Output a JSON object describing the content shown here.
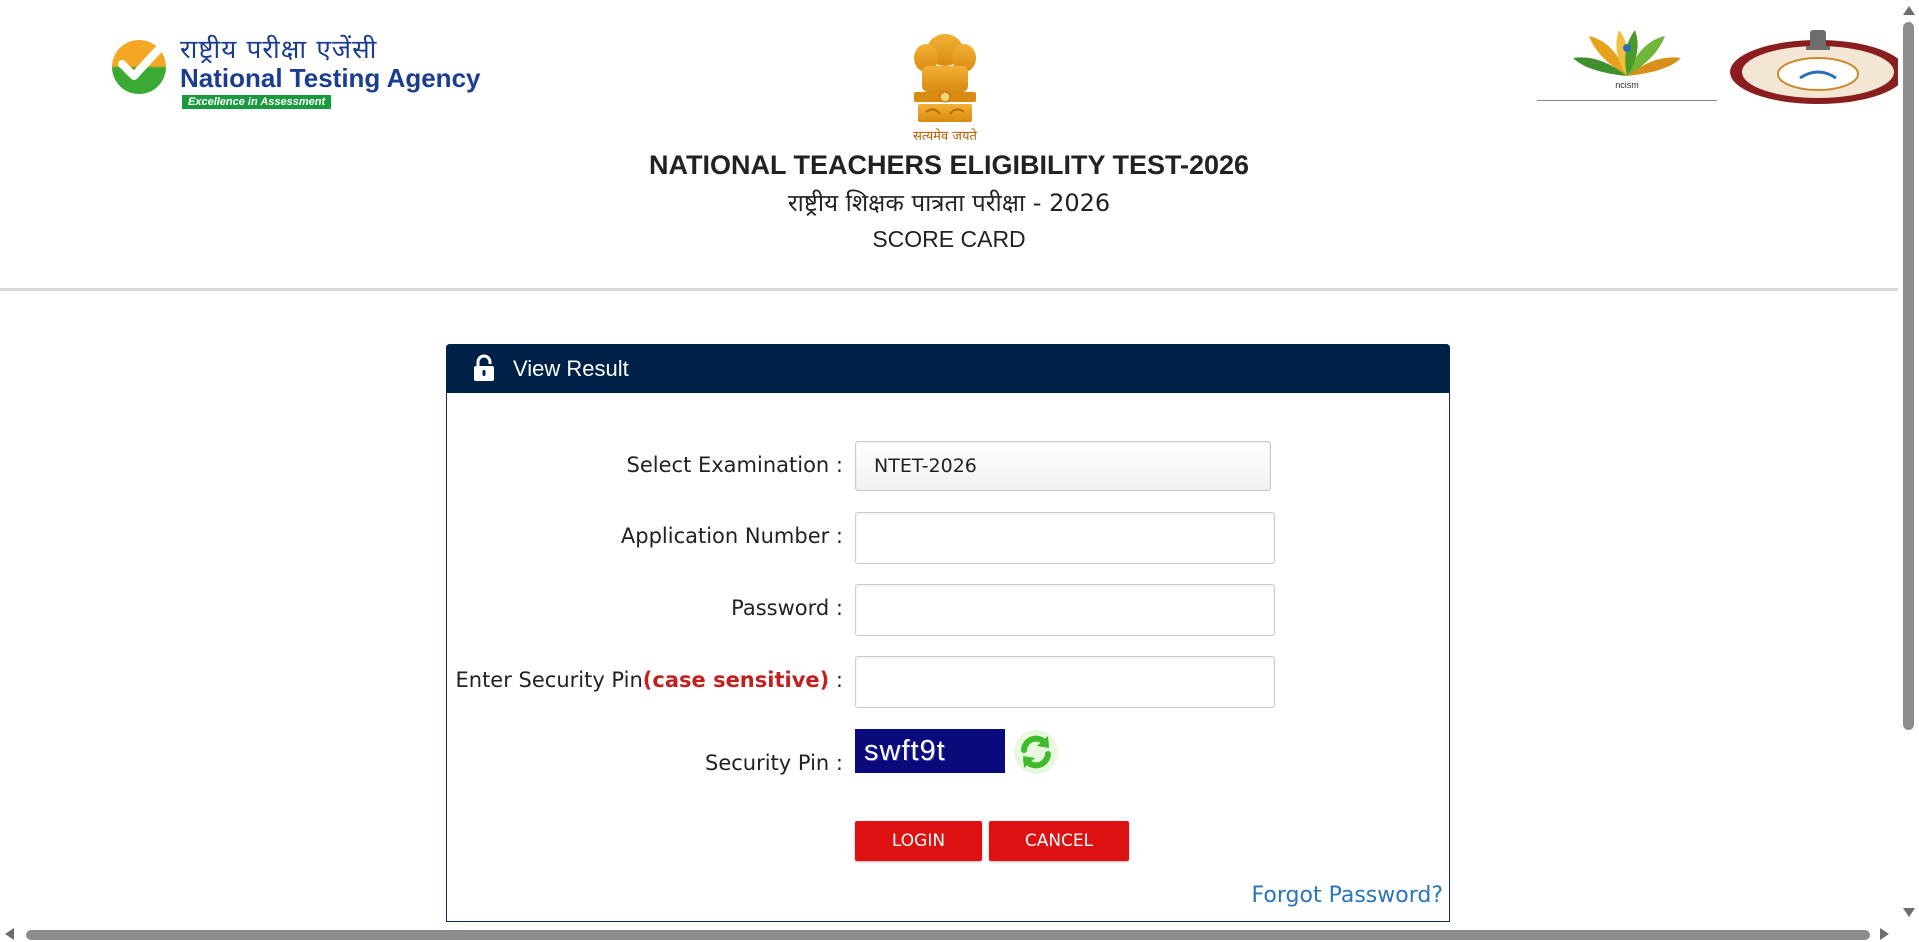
{
  "header": {
    "nta_logo": {
      "hindi_text": "राष्ट्रीय परीक्षा एजेंसी",
      "english_text": "National Testing Agency",
      "tagline": "Excellence in Assessment",
      "icon": "check-circle-icon"
    },
    "emblem": {
      "motto": "सत्यमेव जयते",
      "icon": "national-emblem-icon"
    },
    "partner_logos": {
      "ncism_text": "ncism",
      "ncism_icon": "ncism-logo-icon",
      "nch_icon": "nch-seal-icon"
    },
    "title_english": "NATIONAL TEACHERS ELIGIBILITY TEST-2026",
    "title_hindi": "राष्ट्रीय शिक्षक पात्रता परीक्षा - 2026",
    "subtitle": "SCORE CARD"
  },
  "panel": {
    "title": "View Result",
    "icon": "lock-icon",
    "colors": {
      "header_bg": "#002147",
      "button_bg": "#dd1111",
      "link": "#2a75b8",
      "captcha_bg": "#0a0a7d"
    },
    "fields": {
      "examination": {
        "label": "Select Examination :",
        "selected": "NTET-2026"
      },
      "application_number": {
        "label": "Application Number :",
        "value": "",
        "placeholder": ""
      },
      "password": {
        "label": "Password :",
        "value": "",
        "placeholder": ""
      },
      "security_pin_input": {
        "label_prefix": "Enter Security Pin",
        "label_highlight": "(case sensitive)",
        "label_suffix": " :",
        "value": "",
        "placeholder": ""
      },
      "security_pin": {
        "label": "Security Pin :",
        "captcha_text": "swft9t",
        "refresh_icon": "refresh-icon"
      }
    },
    "buttons": {
      "login": "LOGIN",
      "cancel": "CANCEL"
    },
    "forgot_password": "Forgot Password?"
  }
}
